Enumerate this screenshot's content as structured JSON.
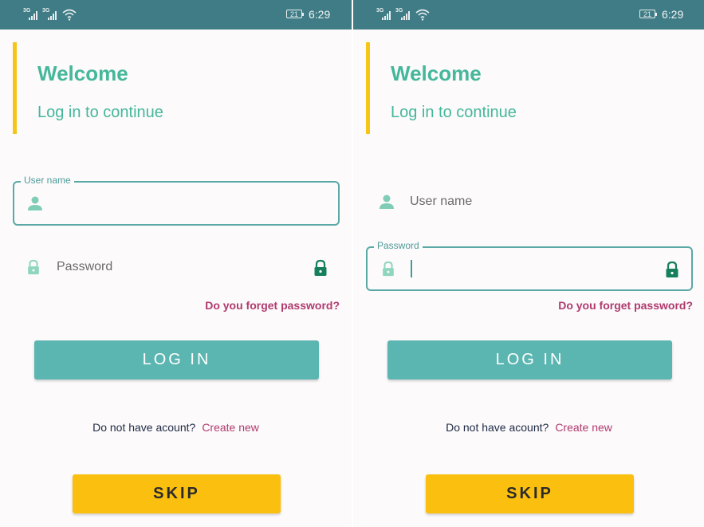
{
  "status_bar": {
    "network_1": "3G",
    "network_2": "3G",
    "battery": "21",
    "time": "6:29"
  },
  "welcome": {
    "title": "Welcome",
    "subtitle": "Log in to continue"
  },
  "form": {
    "username_label": "User name",
    "password_label": "Password",
    "forgot_link": "Do you forget password?"
  },
  "buttons": {
    "login": "LOG IN",
    "skip": "SKIP"
  },
  "signup": {
    "question": "Do not have acount?",
    "link": "Create new"
  },
  "colors": {
    "status_bar": "#3f7c85",
    "accent_green": "#45b79b",
    "login_button": "#5bb5b0",
    "skip_button": "#fbbf0f",
    "link": "#b03a6e",
    "highlight_bar": "#f5c518"
  },
  "icons": {
    "user": "user-icon",
    "lock": "lock-icon",
    "lock_toggle": "lock-toggle-icon"
  }
}
